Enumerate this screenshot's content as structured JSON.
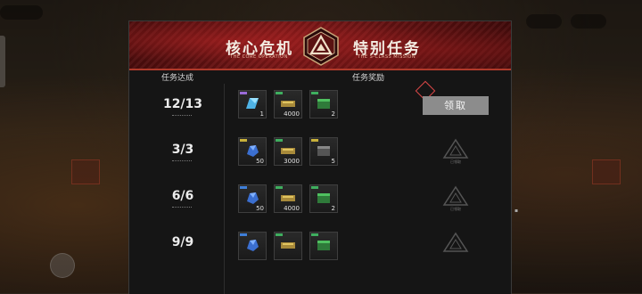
{
  "banner": {
    "title_left": "核心危机",
    "subtitle_left": "THE CORE OPERATION",
    "title_right": "特别任务",
    "subtitle_right": "THE S-CLASS MISSION"
  },
  "headers": {
    "progress": "任务达成",
    "rewards": "任务奖励"
  },
  "missions": [
    {
      "progress": "12/13",
      "rewards": [
        {
          "icon": "blue-crystal-card-icon",
          "qty": "1",
          "tag": "#9a6bd8"
        },
        {
          "icon": "gold-ammo-crate-icon",
          "qty": "4000",
          "tag": "#3fae5f"
        },
        {
          "icon": "green-supply-box-icon",
          "qty": "2",
          "tag": "#3fae5f"
        }
      ],
      "status": "claimable",
      "button": "领取"
    },
    {
      "progress": "3/3",
      "rewards": [
        {
          "icon": "blue-ore-icon",
          "qty": "50",
          "tag": "#c9b13a"
        },
        {
          "icon": "gold-ammo-crate-icon",
          "qty": "3000",
          "tag": "#3fae5f"
        },
        {
          "icon": "gray-supply-box-icon",
          "qty": "5",
          "tag": "#c9b13a"
        }
      ],
      "status": "claimed",
      "claimed_label": "已领取"
    },
    {
      "progress": "6/6",
      "rewards": [
        {
          "icon": "blue-ore-icon",
          "qty": "50",
          "tag": "#3f7fd8"
        },
        {
          "icon": "gold-ammo-crate-icon",
          "qty": "4000",
          "tag": "#3fae5f"
        },
        {
          "icon": "green-supply-box-icon",
          "qty": "2",
          "tag": "#3fae5f"
        }
      ],
      "status": "claimed",
      "claimed_label": "已领取"
    },
    {
      "progress": "9/9",
      "rewards": [
        {
          "icon": "blue-ore-icon",
          "qty": "",
          "tag": "#3f7fd8"
        },
        {
          "icon": "gold-ammo-crate-icon",
          "qty": "",
          "tag": "#3fae5f"
        },
        {
          "icon": "green-supply-box-icon",
          "qty": "",
          "tag": "#3fae5f"
        }
      ],
      "status": "claimed",
      "claimed_label": ""
    }
  ],
  "colors": {
    "accent_red": "#b03a2a",
    "button_gray": "#8c8c8c"
  }
}
